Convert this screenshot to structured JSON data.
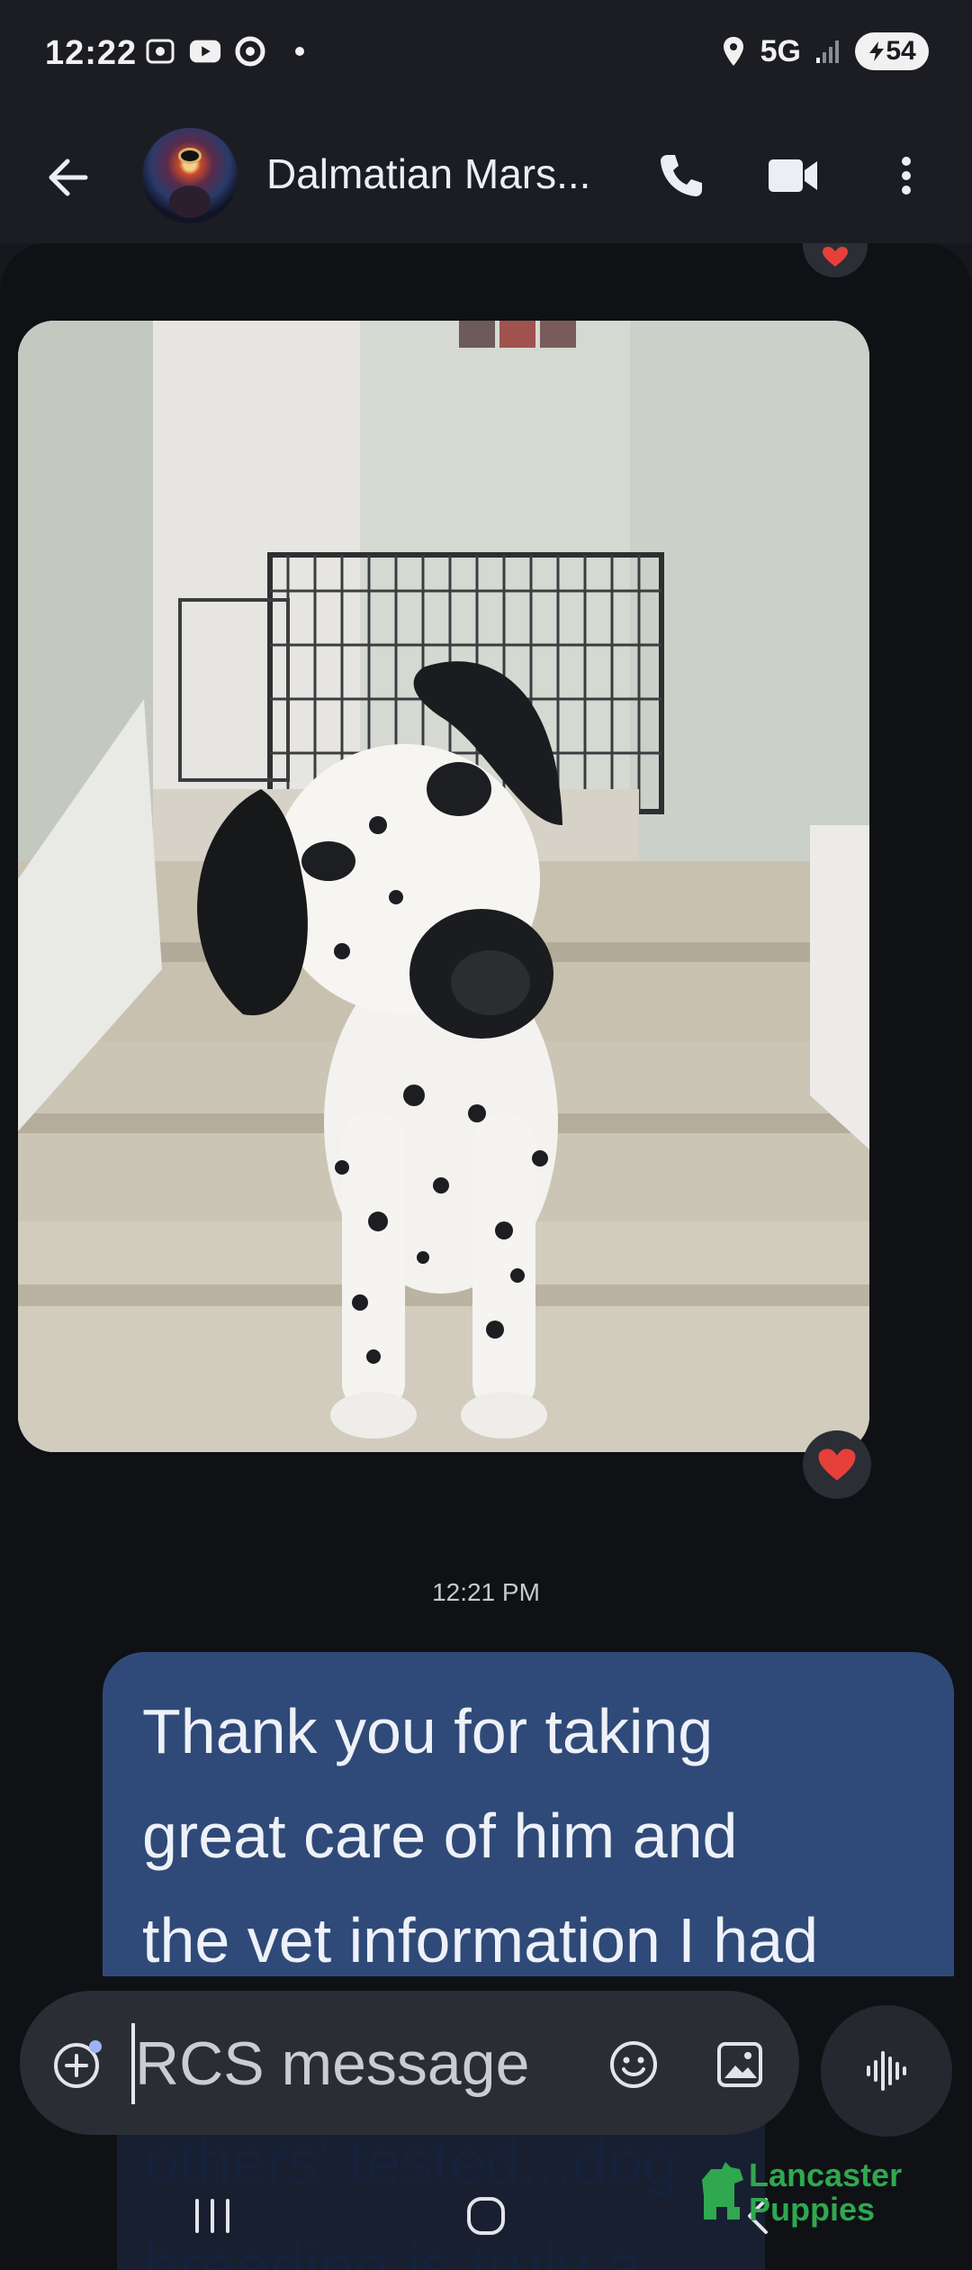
{
  "status_bar": {
    "time": "12:22",
    "network": "5G",
    "battery": "54",
    "icons": [
      "screenshot-icon",
      "youtube-icon",
      "chrome-icon",
      "location-icon",
      "signal-icon"
    ]
  },
  "header": {
    "contact_name": "Dalmatian Mars...",
    "actions": [
      "back-arrow-icon",
      "phone-icon",
      "video-camera-icon",
      "more-vert-icon"
    ]
  },
  "conversation": {
    "received_photo": {
      "description_icon": "dalmatian-photo",
      "reaction": "heart"
    },
    "timestamp": "12:21 PM",
    "sent_message": {
      "lines": [
        "Thank you for taking",
        "great care of him and",
        "the vet information I had"
      ]
    },
    "peek_lines": [
      "others' tested...dog",
      "breeding is truly a"
    ]
  },
  "composer": {
    "placeholder": "RCS message"
  },
  "nav_bar": [
    "recents-icon",
    "home-icon",
    "back-icon"
  ],
  "watermark": {
    "line1": "Lancaster",
    "line2": "Puppies"
  },
  "colors": {
    "sent_bubble": "#2f4a78",
    "background": "#0f1115",
    "heart": "#e6403a",
    "watermark": "#2fa84f"
  }
}
